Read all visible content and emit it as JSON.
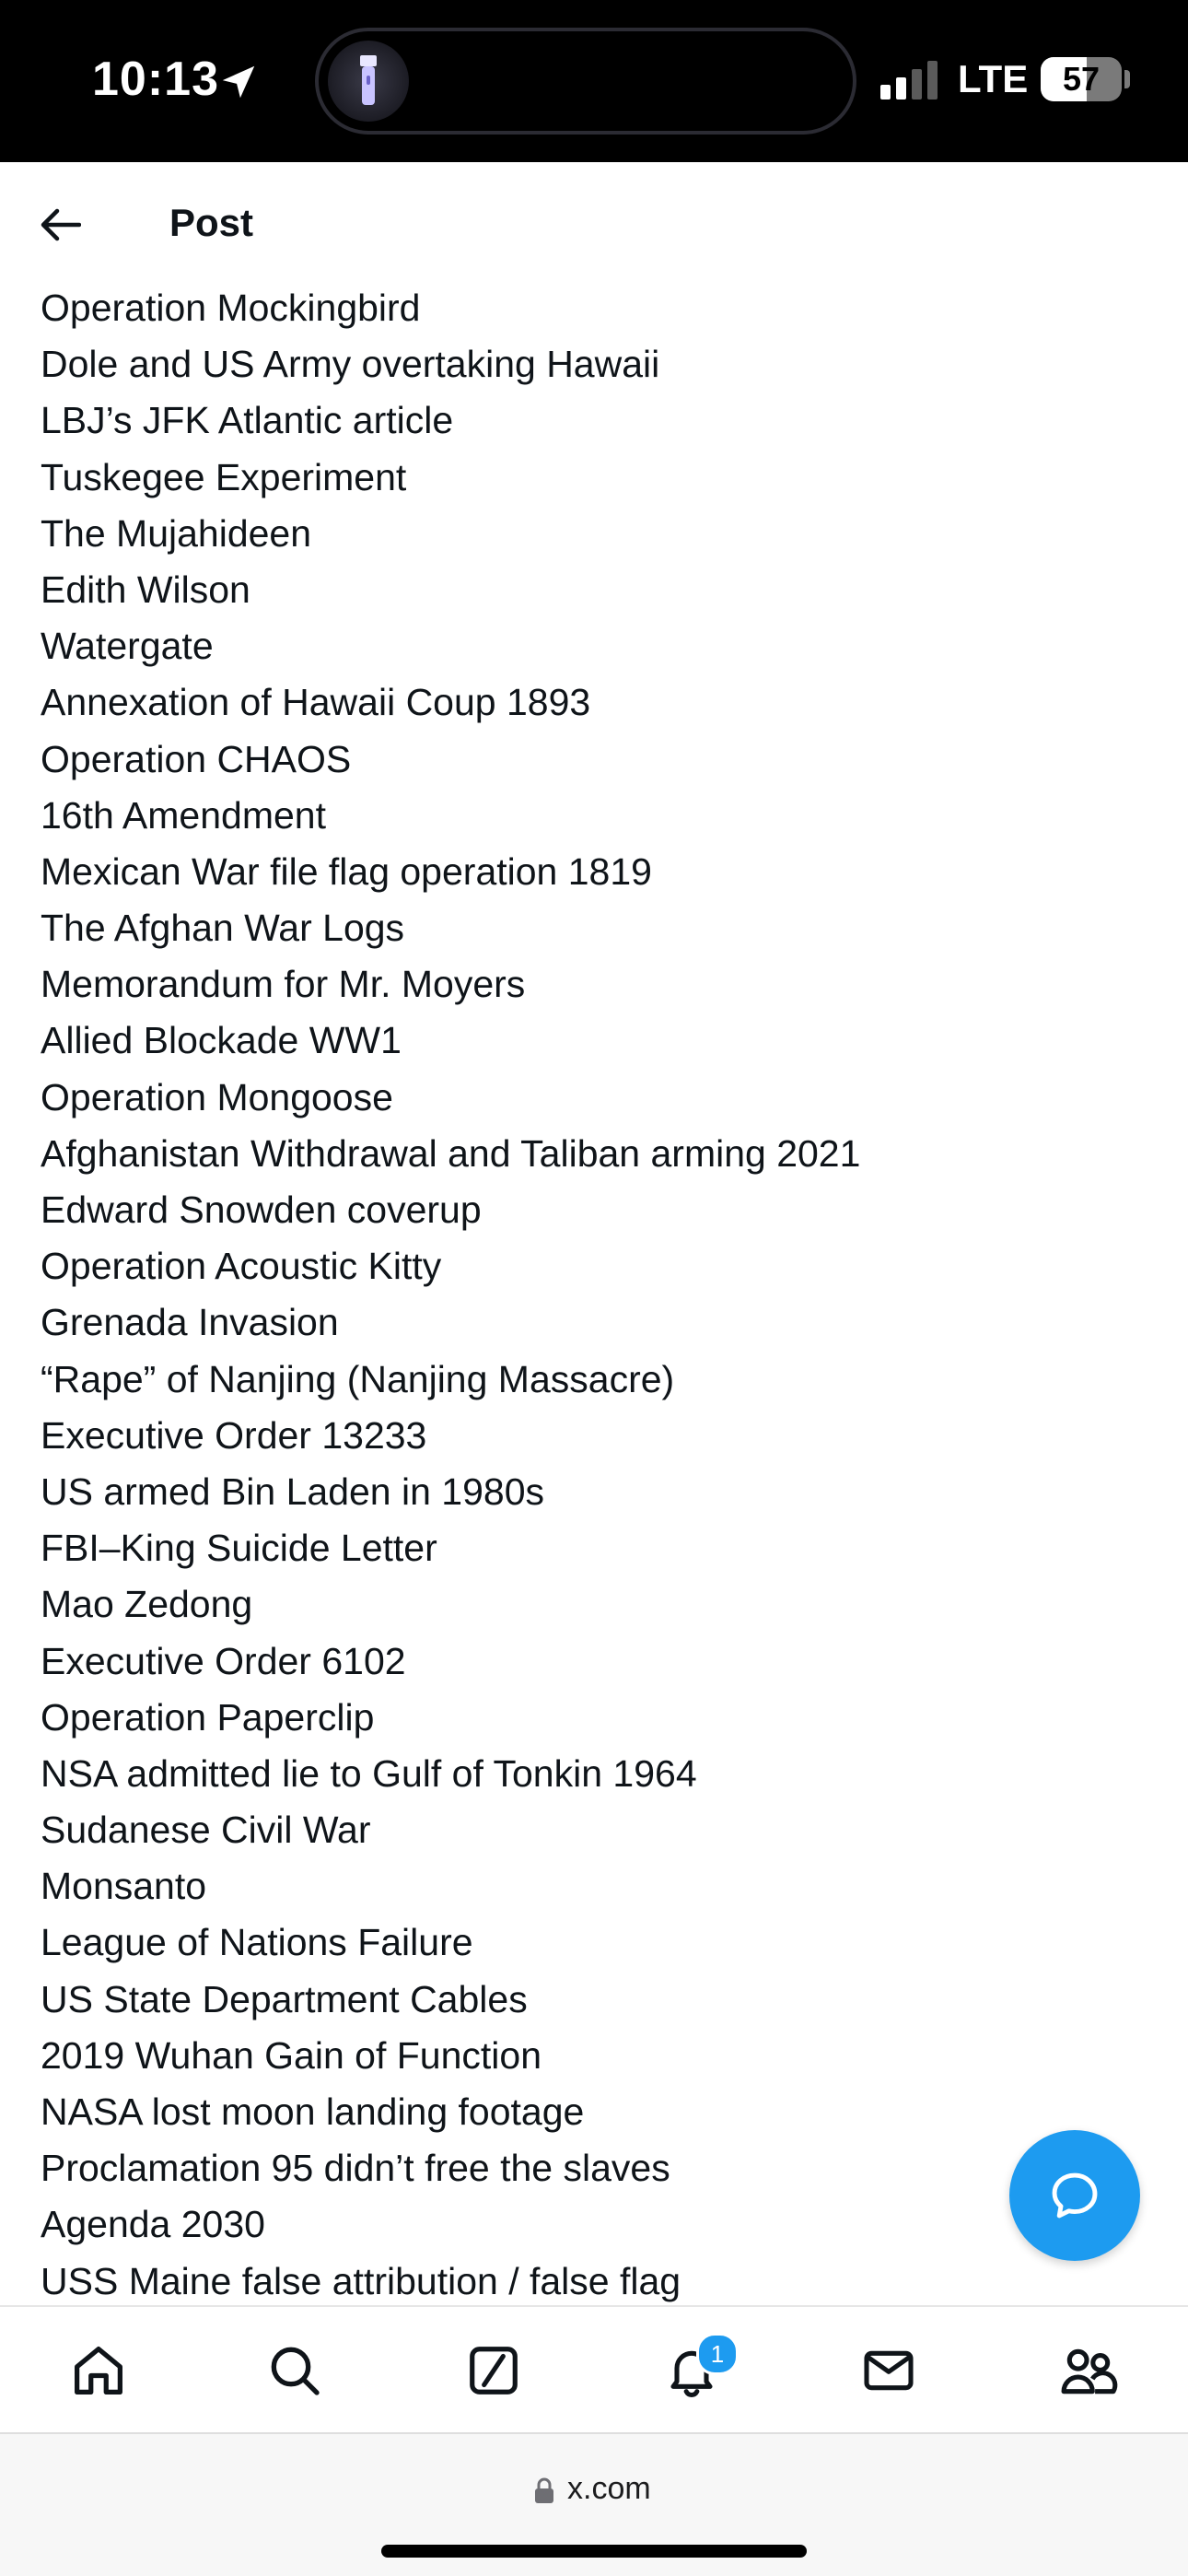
{
  "status_bar": {
    "time": "10:13",
    "network": "LTE",
    "battery_level": "57"
  },
  "header": {
    "title": "Post"
  },
  "post": {
    "lines": [
      "Operation Mockingbird",
      "Dole and US Army overtaking Hawaii",
      "LBJ’s JFK Atlantic article",
      "Tuskegee Experiment",
      "The Mujahideen",
      "Edith Wilson",
      "Watergate",
      "Annexation of Hawaii Coup 1893",
      "Operation CHAOS",
      "16th Amendment",
      "Mexican War file flag operation 1819",
      "The Afghan War Logs",
      "Memorandum for Mr. Moyers",
      "Allied Blockade WW1",
      "Operation Mongoose",
      "Afghanistan Withdrawal and Taliban arming 2021",
      "Edward Snowden coverup",
      "Operation Acoustic Kitty",
      "Grenada Invasion",
      "“Rape” of Nanjing (Nanjing Massacre)",
      "Executive Order 13233",
      "US armed Bin Laden in 1980s",
      "FBI–King Suicide Letter",
      "Mao Zedong",
      "Executive Order 6102",
      "Operation Paperclip",
      "NSA admitted lie to Gulf of Tonkin 1964",
      "Sudanese Civil War",
      "Monsanto",
      "League of Nations Failure",
      "US State Department Cables",
      "2019 Wuhan Gain of Function",
      "NASA lost moon landing footage",
      "Proclamation 95 didn’t free the slaves",
      "Agenda 2030",
      "USS Maine false attribution / false flag"
    ]
  },
  "tab_bar": {
    "items": [
      {
        "icon": "home-icon"
      },
      {
        "icon": "search-icon"
      },
      {
        "icon": "grok-icon"
      },
      {
        "icon": "notifications-icon",
        "badge": "1"
      },
      {
        "icon": "messages-icon"
      },
      {
        "icon": "communities-icon"
      }
    ]
  },
  "address_bar": {
    "url": "x.com"
  },
  "colors": {
    "accent": "#1d9bf0",
    "text": "#0f1419",
    "status_bar_bg": "#000000"
  }
}
